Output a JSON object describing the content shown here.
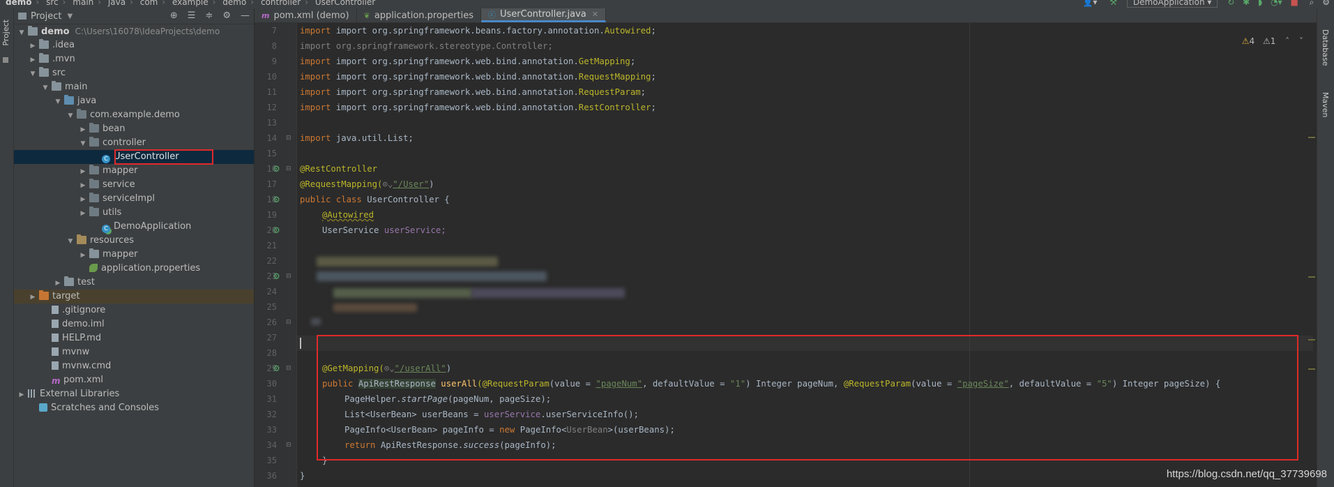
{
  "breadcrumb": [
    "demo",
    "src",
    "main",
    "java",
    "com",
    "example",
    "demo",
    "controller",
    "UserController"
  ],
  "toolbar": {
    "run_config": "DemoApplication"
  },
  "project_panel": {
    "title": "Project",
    "tree": {
      "root": {
        "label": "demo",
        "path": "C:\\Users\\16078\\IdeaProjects\\demo"
      },
      "idea": ".idea",
      "mvn": ".mvn",
      "src": "src",
      "main": "main",
      "java": "java",
      "pkg": "com.example.demo",
      "bean": "bean",
      "controller": "controller",
      "usercontroller": "UserController",
      "mapper": "mapper",
      "service": "service",
      "serviceimpl": "serviceImpl",
      "utils": "utils",
      "demoapp": "DemoApplication",
      "resources": "resources",
      "res_mapper": "mapper",
      "app_props": "application.properties",
      "test": "test",
      "target": "target",
      "gitignore": ".gitignore",
      "demoiml": "demo.iml",
      "help": "HELP.md",
      "mvnw": "mvnw",
      "mvnwcmd": "mvnw.cmd",
      "pom": "pom.xml",
      "extlib": "External Libraries",
      "scratches": "Scratches and Consoles"
    }
  },
  "tabs": [
    {
      "label": "pom.xml (demo)",
      "icon": "m"
    },
    {
      "label": "application.properties",
      "icon": "leaf"
    },
    {
      "label": "UserController.java",
      "icon": "c"
    }
  ],
  "inspection": {
    "warnings": "4",
    "weak": "1"
  },
  "editor": {
    "line_numbers": [
      "7",
      "8",
      "9",
      "10",
      "11",
      "12",
      "13",
      "14",
      "15",
      "16",
      "17",
      "18",
      "19",
      "20",
      "21",
      "22",
      "23",
      "24",
      "25",
      "26",
      "27",
      "28",
      "29",
      "30",
      "31",
      "32",
      "33",
      "34",
      "35",
      "36"
    ],
    "imports": {
      "l7_pkg": "import org.springframework.beans.factory.annotation.",
      "l7_cls": "Autowired",
      "l8": "import org.springframework.stereotype.Controller;",
      "l9_pkg": "import org.springframework.web.bind.annotation.",
      "l9_cls": "GetMapping",
      "l10_cls": "RequestMapping",
      "l11_cls": "RequestParam",
      "l12_cls": "RestController",
      "l14": "java.util.List;"
    },
    "code": {
      "restcontroller": "@RestController",
      "requestmapping": "@RequestMapping(",
      "requestmapping_path": "\"/User\"",
      "class_decl_kw": "public class",
      "class_name": "UserController {",
      "autowired": "@Autowired",
      "field_type": "UserService",
      "field_name": "userService;",
      "getmapping": "@GetMapping(",
      "getmapping_path": "\"/userAll\"",
      "m_public": "public",
      "m_type": "ApiRestResponse",
      "m_name": "userAll",
      "m_p1a": "(@RequestParam(value = ",
      "m_p1_val": "\"pageNum\"",
      "m_p1b": ", defaultValue = ",
      "m_p1_def": "\"1\"",
      "m_p1c": ") Integer pageNum, ",
      "m_p2a": "@RequestParam(",
      "m_p2b": "value = ",
      "m_p2_val": "\"pageSize\"",
      "m_p2_def": "\"5\"",
      "m_p2c": ") Integer pageSize) {",
      "l30a": "PageHelper.",
      "l30b": "startPage",
      "l30c": "(pageNum, pageSize);",
      "l31a": "List<UserBean> userBeans = ",
      "l31b": "userService",
      "l31c": ".userServiceInfo();",
      "l32a": "PageInfo<UserBean> pageInfo = ",
      "l32b": "new",
      "l32c": " PageInfo<",
      "l32d": "UserBean",
      "l32e": ">(userBeans);",
      "l33a": "return",
      "l33b": " ApiRestResponse.",
      "l33c": "success",
      "l33d": "(pageInfo);",
      "l34": "}",
      "l35": "}"
    }
  },
  "right_strip": {
    "database": "Database",
    "maven": "Maven"
  },
  "watermark": "https://blog.csdn.net/qq_37739698",
  "colors": {
    "highlight_box": "#e02a2a",
    "selected_row": "#0d293e",
    "tab_active_underline": "#4a88c7"
  }
}
